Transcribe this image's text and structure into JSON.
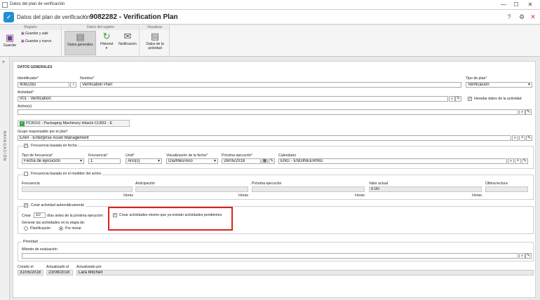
{
  "window": {
    "title": "Datos del plan de verificación",
    "min": "—",
    "max": "☐",
    "close": "✕"
  },
  "header": {
    "crumb": "Datos del plan de verificación",
    "separator": "›",
    "record": "9082282 - Verification Plan"
  },
  "ribbon": {
    "groups": [
      "Registro",
      "Datos del registro",
      "Visualizar"
    ],
    "save": "Guardar",
    "save_exit": "Guardar y salir",
    "save_new": "Guardar y nuevo",
    "general": "Datos generales",
    "history": "Historial",
    "notification": "Notificación",
    "activity_data": "Datos de la actividad"
  },
  "sidebar": {
    "label": "NAVEGACIÓN",
    "toggle": "»"
  },
  "section_title": "DATOS GENERALES",
  "form": {
    "id_label": "Identificador",
    "id_value": "9082282",
    "name_label": "Nombre",
    "name_value": "Verification Plan",
    "plan_type_label": "Tipo de plan",
    "plan_type_value": "Verificación",
    "activity_label": "Actividad",
    "activity_value": "001 - Verification",
    "inherit_label": "Heredar datos de la actividad",
    "assets_label": "Activo(s)",
    "asset_tag": "PCK010 - Packaging Machinery Hitachi CLB92 - E",
    "group_label": "Grupo responsable por el plan",
    "group_value": "EAM - Enterprise Asset Management",
    "freq_date_label": "Frecuencia basada en fecha",
    "freq_type_label": "Tipo de frecuencia",
    "freq_type_value": "Fecha de ejecución",
    "freq_label": "Frecuencia",
    "freq_value": "1",
    "unit_label": "Unid",
    "unit_value": "Año(s)",
    "date_view_label": "Visualización de la fecha",
    "date_view_value": "Día/Mes/Año",
    "next_exec_label": "Próxima ejecución",
    "next_exec_value": "26/05/2018",
    "calendar_label": "Calendario",
    "calendar_value": "ENG - ENGINEERING",
    "freq_meter_label": "Frecuencia basada en el medidor del activo",
    "m_freq_label": "Frecuencia",
    "m_antic_label": "Anticipación",
    "m_next_label": "Próxima ejecución",
    "m_current_label": "Valor actual",
    "m_current_value": "0.00",
    "m_last_label": "Última lectura",
    "hours": "Horas",
    "auto_create_label": "Crear actividad automáticamente",
    "create_label": "Crear",
    "create_days": "10",
    "days_before": "días antes de la próxima ejecución",
    "create_pending": "Crear actividades mismo que ya existan actividades pendientes",
    "generate_label": "Generar las actividades en la etapa de:",
    "stage_plan": "Planificación",
    "stage_start": "Por iniciar",
    "priority_legend": "Prioridad",
    "eval_label": "Método de evaluación",
    "created_label": "Creado el",
    "created_value": "31/05/2018",
    "updated_label": "Actualizado el",
    "updated_value": "23/08/2018",
    "updated_by_label": "Actualizado por",
    "updated_by_value": "Lara Mitchell"
  },
  "icons": {
    "search": "⌕",
    "clear": "✎",
    "arrow": "›",
    "check": "✓",
    "calendar": "▦",
    "plus": "+"
  }
}
